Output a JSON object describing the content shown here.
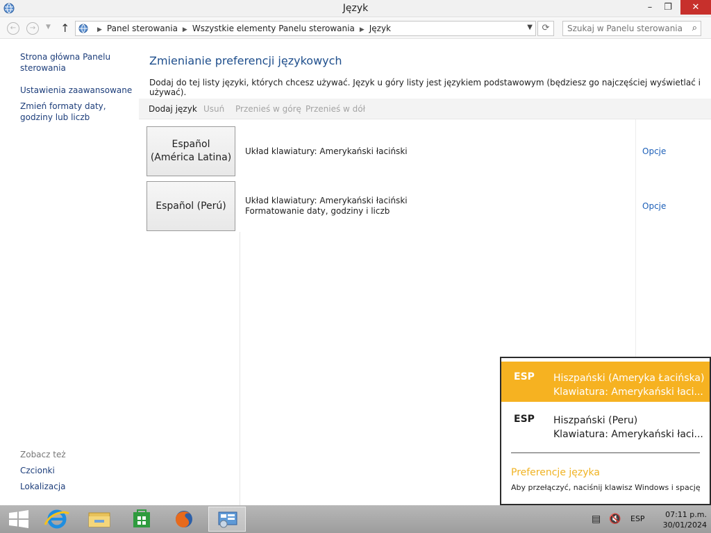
{
  "window": {
    "title": "Język"
  },
  "window_controls": {
    "minimize": "–",
    "maximize": "❐",
    "close": "✕"
  },
  "nav": {
    "breadcrumbs": [
      "Panel sterowania",
      "Wszystkie elementy Panelu sterowania",
      "Język"
    ],
    "search_placeholder": "Szukaj w Panelu sterowania"
  },
  "sidebar": {
    "links": [
      "Strona główna Panelu sterowania",
      "Ustawienia zaawansowane",
      "Zmień formaty daty, godziny lub liczb"
    ],
    "see_also_heading": "Zobacz też",
    "see_also_links": [
      "Czcionki",
      "Lokalizacja"
    ]
  },
  "main": {
    "title": "Zmienianie preferencji językowych",
    "description": "Dodaj do tej listy języki, których chcesz używać. Język u góry listy jest językiem podstawowym (będziesz go najczęściej wyświetlać i używać).",
    "toolbar": [
      {
        "label": "Dodaj język",
        "enabled": true
      },
      {
        "label": "Usuń",
        "enabled": false
      },
      {
        "label": "Przenieś w górę",
        "enabled": false
      },
      {
        "label": "Przenieś w dół",
        "enabled": false
      }
    ],
    "languages": [
      {
        "name": "Español (América Latina)",
        "info": [
          "Układ klawiatury: Amerykański łaciński"
        ],
        "options_label": "Opcje"
      },
      {
        "name": "Español (Perú)",
        "info": [
          "Układ klawiatury: Amerykański łaciński",
          "Formatowanie daty, godziny i liczb"
        ],
        "options_label": "Opcje"
      }
    ]
  },
  "flyout": {
    "items": [
      {
        "code": "ESP",
        "name": "Hiszpański (Ameryka Łacińska)",
        "keyboard": "Klawiatura: Amerykański łaci...",
        "selected": true
      },
      {
        "code": "ESP",
        "name": "Hiszpański (Peru)",
        "keyboard": "Klawiatura: Amerykański łaci...",
        "selected": false
      }
    ],
    "preferences_link": "Preferencje języka",
    "hint": "Aby przełączyć, naciśnij klawisz Windows i spację"
  },
  "taskbar": {
    "apps": [
      "start-button",
      "internet-explorer",
      "file-explorer",
      "windows-store",
      "firefox",
      "control-panel"
    ],
    "tray": {
      "language": "ESP",
      "time": "07:11 p.m.",
      "date": "30/01/2024"
    }
  },
  "colors": {
    "link": "#1c3d7a",
    "title_blue": "#1e4e8c",
    "flyout_selected": "#f6b221",
    "close_button": "#c7302c"
  }
}
